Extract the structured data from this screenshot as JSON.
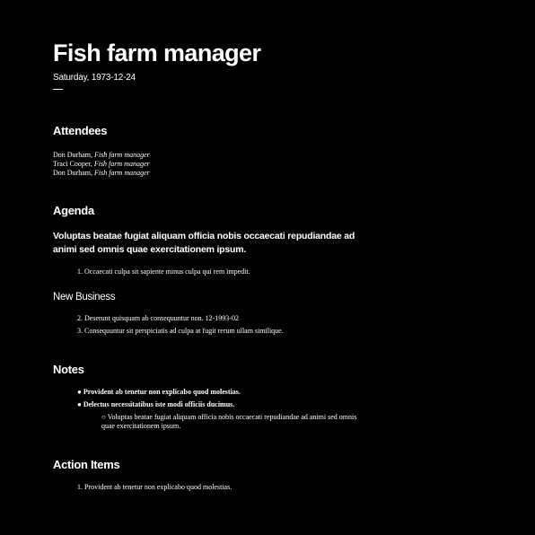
{
  "header": {
    "title": "Fish farm manager",
    "date": "Saturday, 1973-12-24"
  },
  "attendees": {
    "heading": "Attendees",
    "people": [
      {
        "name": "Don Durham",
        "role": "Fish farm manager"
      },
      {
        "name": "Traci Cooper",
        "role": "Fish farm manager"
      },
      {
        "name": "Don Durham",
        "role": "Fish farm manager"
      }
    ]
  },
  "agenda": {
    "heading": "Agenda",
    "lead": "Voluptas beatae fugiat aliquam officia nobis occaecati repudiandae ad animi sed omnis quae exercitationem ipsum.",
    "items": [
      {
        "number": "1.",
        "text": "Occaecati culpa sit sapiente minus culpa qui rem impedit."
      }
    ],
    "new_business_heading": "New Business",
    "new_business_items": [
      {
        "number": "2.",
        "text": "Deserunt quisquam ab consequuntur non. 12-1993-02"
      },
      {
        "number": "3.",
        "text": "Consequuntur sit perspiciatis ad culpa at fugit rerum ullam similique."
      }
    ]
  },
  "notes": {
    "heading": "Notes",
    "items": [
      {
        "bullet": "●",
        "text": "Provident ab tenetur non explicabo quod molestias."
      },
      {
        "bullet": "●",
        "text": "Delectus necessitatibus iste modi officiis ducimus."
      }
    ],
    "sub_items": [
      {
        "bullet": "○",
        "text": "Voluptas beatae fugiat aliquam officia nobis occaecati repudiandae ad animi sed omnis quae exercitationem ipsum."
      }
    ]
  },
  "action_items": {
    "heading": "Action Items",
    "items": [
      {
        "number": "1.",
        "text": "Provident ab tenetur non explicabo quod molestias."
      }
    ]
  }
}
